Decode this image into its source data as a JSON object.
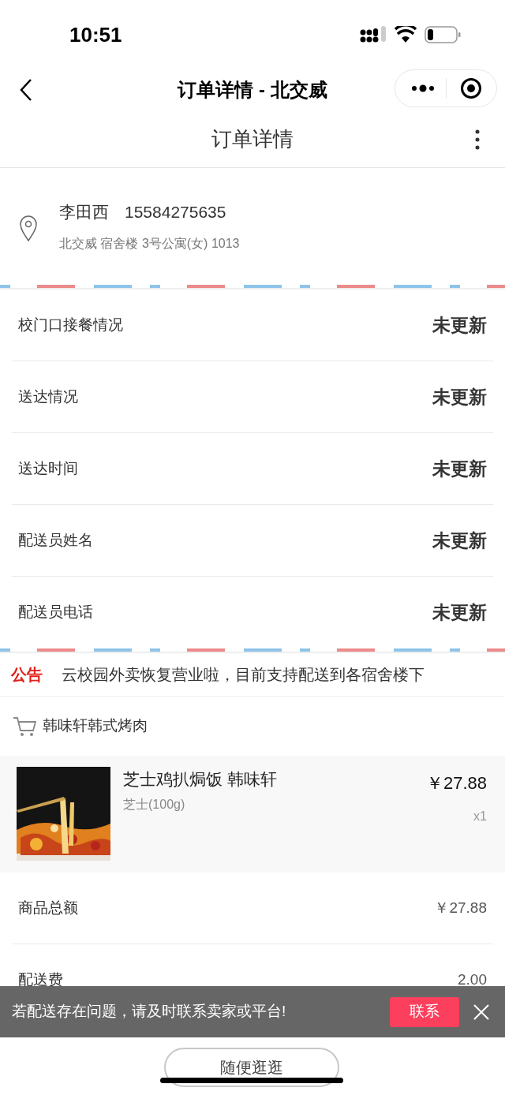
{
  "status_bar": {
    "time": "10:51"
  },
  "nav_bar": {
    "title": "订单详情 - 北交威"
  },
  "header": {
    "title": "订单详情"
  },
  "address": {
    "name": "李田西",
    "phone": "15584275635",
    "detail": "北交威 宿舍楼 3号公寓(女) 1013"
  },
  "info_rows": [
    {
      "label": "校门口接餐情况",
      "value": "未更新"
    },
    {
      "label": "送达情况",
      "value": "未更新"
    },
    {
      "label": "送达时间",
      "value": "未更新"
    },
    {
      "label": "配送员姓名",
      "value": "未更新"
    },
    {
      "label": "配送员电话",
      "value": "未更新"
    }
  ],
  "notice": {
    "tag": "公告",
    "text": "云校园外卖恢复营业啦，目前支持配送到各宿舍楼下"
  },
  "shop": {
    "name": "韩味轩韩式烤肉"
  },
  "items": [
    {
      "name": "芝士鸡扒焗饭 韩味轩",
      "spec": "芝士(100g)",
      "price": "￥27.88",
      "qty": "x1"
    }
  ],
  "summary": [
    {
      "label": "商品总额",
      "value": "￥27.88"
    },
    {
      "label": "配送费",
      "value": "2.00"
    }
  ],
  "banner": {
    "text": "若配送存在问题，请及时联系卖家或平台!",
    "button": "联系"
  },
  "bottom_button": "随便逛逛"
}
